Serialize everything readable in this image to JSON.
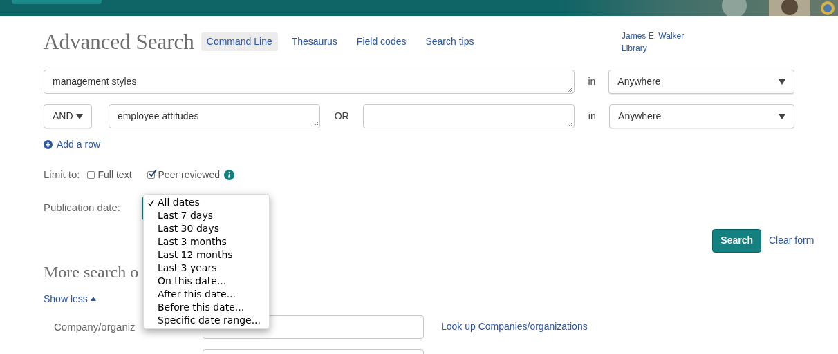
{
  "header": {
    "title": "Advanced Search",
    "tabs": [
      {
        "label": "Command Line",
        "selected": true
      },
      {
        "label": "Thesaurus",
        "selected": false
      },
      {
        "label": "Field codes",
        "selected": false
      },
      {
        "label": "Search tips",
        "selected": false
      }
    ],
    "library": "James E. Walker Library"
  },
  "search_rows": [
    {
      "kind": "first",
      "term": "management styles",
      "in_label": "in",
      "field": "Anywhere"
    },
    {
      "kind": "combined",
      "operator": "AND",
      "term": "employee attitudes",
      "or_label": "OR",
      "in_label": "in",
      "field": "Anywhere"
    }
  ],
  "add_row": "Add a row",
  "limit": {
    "label": "Limit to:",
    "options": [
      {
        "label": "Full text",
        "checked": false,
        "info": false
      },
      {
        "label": "Peer reviewed",
        "checked": true,
        "info": true
      }
    ]
  },
  "publication_date": {
    "label": "Publication date:",
    "options": [
      {
        "label": "All dates",
        "selected": true
      },
      {
        "label": "Last 7 days",
        "selected": false
      },
      {
        "label": "Last 30 days",
        "selected": false
      },
      {
        "label": "Last 3 months",
        "selected": false
      },
      {
        "label": "Last 12 months",
        "selected": false
      },
      {
        "label": "Last 3 years",
        "selected": false
      },
      {
        "label": "On this date...",
        "selected": false
      },
      {
        "label": "After this date...",
        "selected": false
      },
      {
        "label": "Before this date...",
        "selected": false
      },
      {
        "label": "Specific date range...",
        "selected": false
      }
    ]
  },
  "actions": {
    "search": "Search",
    "clear": "Clear form"
  },
  "more": {
    "title": "More search o",
    "toggle": "Show less",
    "company_label": "Company/organiz",
    "lookup": "Look up Companies/organizations"
  }
}
